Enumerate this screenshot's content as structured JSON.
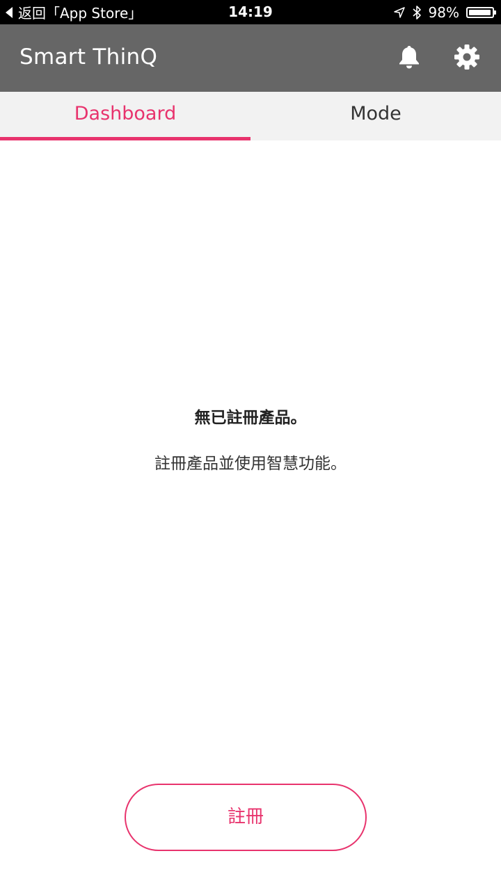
{
  "status_bar": {
    "back_label": "返回「App Store」",
    "time": "14:19",
    "battery_percent": "98%",
    "battery_level": 0.98
  },
  "header": {
    "title": "Smart ThinQ",
    "icons": [
      "bell-icon",
      "gear-icon"
    ]
  },
  "tabs": [
    {
      "label": "Dashboard",
      "active": true
    },
    {
      "label": "Mode",
      "active": false
    }
  ],
  "empty_state": {
    "title": "無已註冊產品。",
    "description": "註冊產品並使用智慧功能。"
  },
  "register_button": {
    "label": "註冊"
  },
  "colors": {
    "accent": "#e8336d",
    "header_bg": "#666666",
    "tab_bg": "#f2f2f2"
  }
}
